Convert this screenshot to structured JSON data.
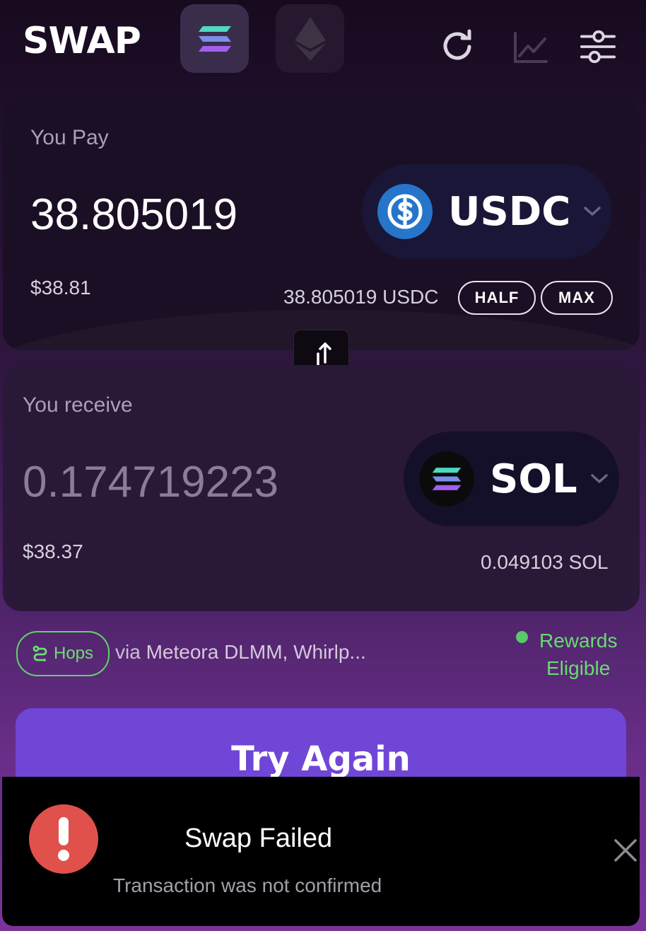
{
  "app": {
    "logo": "SWAP"
  },
  "header": {
    "chains": [
      {
        "name": "solana-chain",
        "active": true
      },
      {
        "name": "ethereum-chain",
        "active": false
      }
    ],
    "icons": [
      "refresh-icon",
      "chart-icon",
      "settings-sliders-icon"
    ]
  },
  "pay": {
    "label": "You Pay",
    "amount": "38.805019",
    "usd_value": "$38.81",
    "token": "USDC",
    "token_icon": "usdc-icon",
    "balance": "38.805019 USDC",
    "half_label": "HALF",
    "max_label": "MAX"
  },
  "receive": {
    "label": "You receive",
    "amount": "0.174719223",
    "usd_value": "$38.37",
    "token": "SOL",
    "token_icon": "sol-icon",
    "balance": "0.049103 SOL"
  },
  "route": {
    "hops_label": "Hops",
    "via_prefix": "via",
    "via_text": "Meteora DLMM, Whirlp...",
    "rewards_line1": "Rewards",
    "rewards_line2": "Eligible"
  },
  "action": {
    "button_label": "Try Again"
  },
  "toast": {
    "title": "Swap Failed",
    "message": "Transaction was not confirmed"
  },
  "colors": {
    "accent_button": "#7046d6",
    "success_green": "#66dd6e",
    "error_red": "#e0514b",
    "usdc_blue": "#2775ca"
  }
}
